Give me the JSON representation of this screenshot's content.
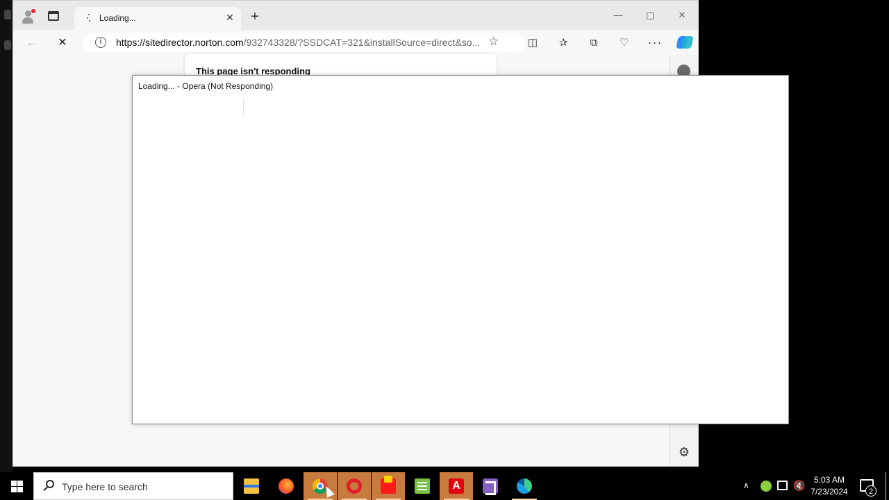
{
  "edge": {
    "tab_title": "Loading...",
    "url_host": "https://sitedirector.norton.com",
    "url_rest": "/932743328/?SSDCAT=321&installSource=direct&so...",
    "dialog_title": "This page isn't responding"
  },
  "opera_dialog": {
    "title": "Loading... - Opera (Not Responding)"
  },
  "taskbar": {
    "search_placeholder": "Type here to search",
    "apps": [
      "file-explorer",
      "firefox",
      "chrome",
      "opera",
      "norton",
      "notepad-plus-plus",
      "avira",
      "visual-studio",
      "edge"
    ],
    "active_app": "chrome",
    "time": "5:03 AM",
    "date": "7/23/2024",
    "notification_count": "2"
  },
  "colors": {
    "taskbar": "#000000",
    "active_app_highlight": "#c87b3e",
    "copilot_blue": "#2b8fff"
  }
}
